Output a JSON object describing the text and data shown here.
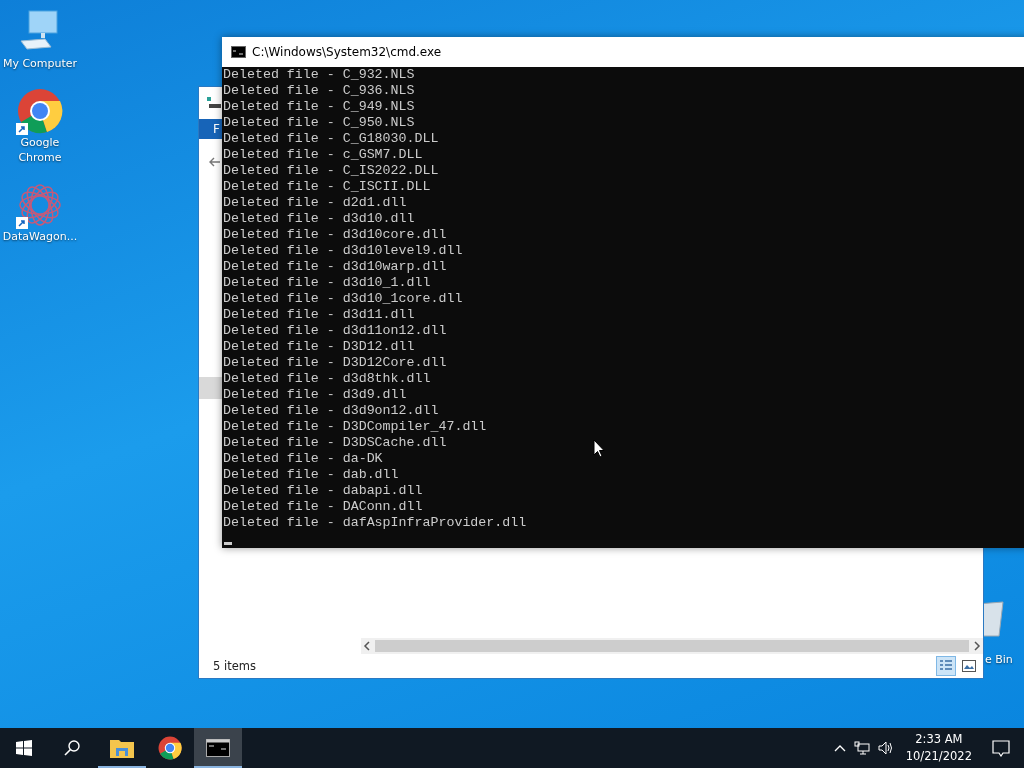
{
  "desktop_icons": [
    {
      "kind": "computer",
      "label": "My Computer"
    },
    {
      "kind": "chrome",
      "label": "Google Chrome"
    },
    {
      "kind": "datawagon",
      "label": "DataWagon..."
    }
  ],
  "recycle_bin": {
    "label": "e Bin"
  },
  "explorer": {
    "ribbon_tab": "F",
    "status": "5 items",
    "views": [
      {
        "kind": "details",
        "selected": true
      },
      {
        "kind": "tiles",
        "selected": false
      }
    ]
  },
  "console": {
    "title": "C:\\Windows\\System32\\cmd.exe",
    "lines": [
      "Deleted file - C_932.NLS",
      "Deleted file - C_936.NLS",
      "Deleted file - C_949.NLS",
      "Deleted file - C_950.NLS",
      "Deleted file - C_G18030.DLL",
      "Deleted file - c_GSM7.DLL",
      "Deleted file - C_IS2022.DLL",
      "Deleted file - C_ISCII.DLL",
      "Deleted file - d2d1.dll",
      "Deleted file - d3d10.dll",
      "Deleted file - d3d10core.dll",
      "Deleted file - d3d10level9.dll",
      "Deleted file - d3d10warp.dll",
      "Deleted file - d3d10_1.dll",
      "Deleted file - d3d10_1core.dll",
      "Deleted file - d3d11.dll",
      "Deleted file - d3d11on12.dll",
      "Deleted file - D3D12.dll",
      "Deleted file - D3D12Core.dll",
      "Deleted file - d3d8thk.dll",
      "Deleted file - d3d9.dll",
      "Deleted file - d3d9on12.dll",
      "Deleted file - D3DCompiler_47.dll",
      "Deleted file - D3DSCache.dll",
      "Deleted file - da-DK",
      "Deleted file - dab.dll",
      "Deleted file - dabapi.dll",
      "Deleted file - DAConn.dll",
      "Deleted file - dafAspInfraProvider.dll"
    ]
  },
  "taskbar": {
    "apps": [
      {
        "kind": "explorer",
        "running": true,
        "active": false
      },
      {
        "kind": "chrome",
        "running": false,
        "active": false
      },
      {
        "kind": "cmd",
        "running": true,
        "active": true
      }
    ],
    "time": "2:33 AM",
    "date": "10/21/2022"
  }
}
